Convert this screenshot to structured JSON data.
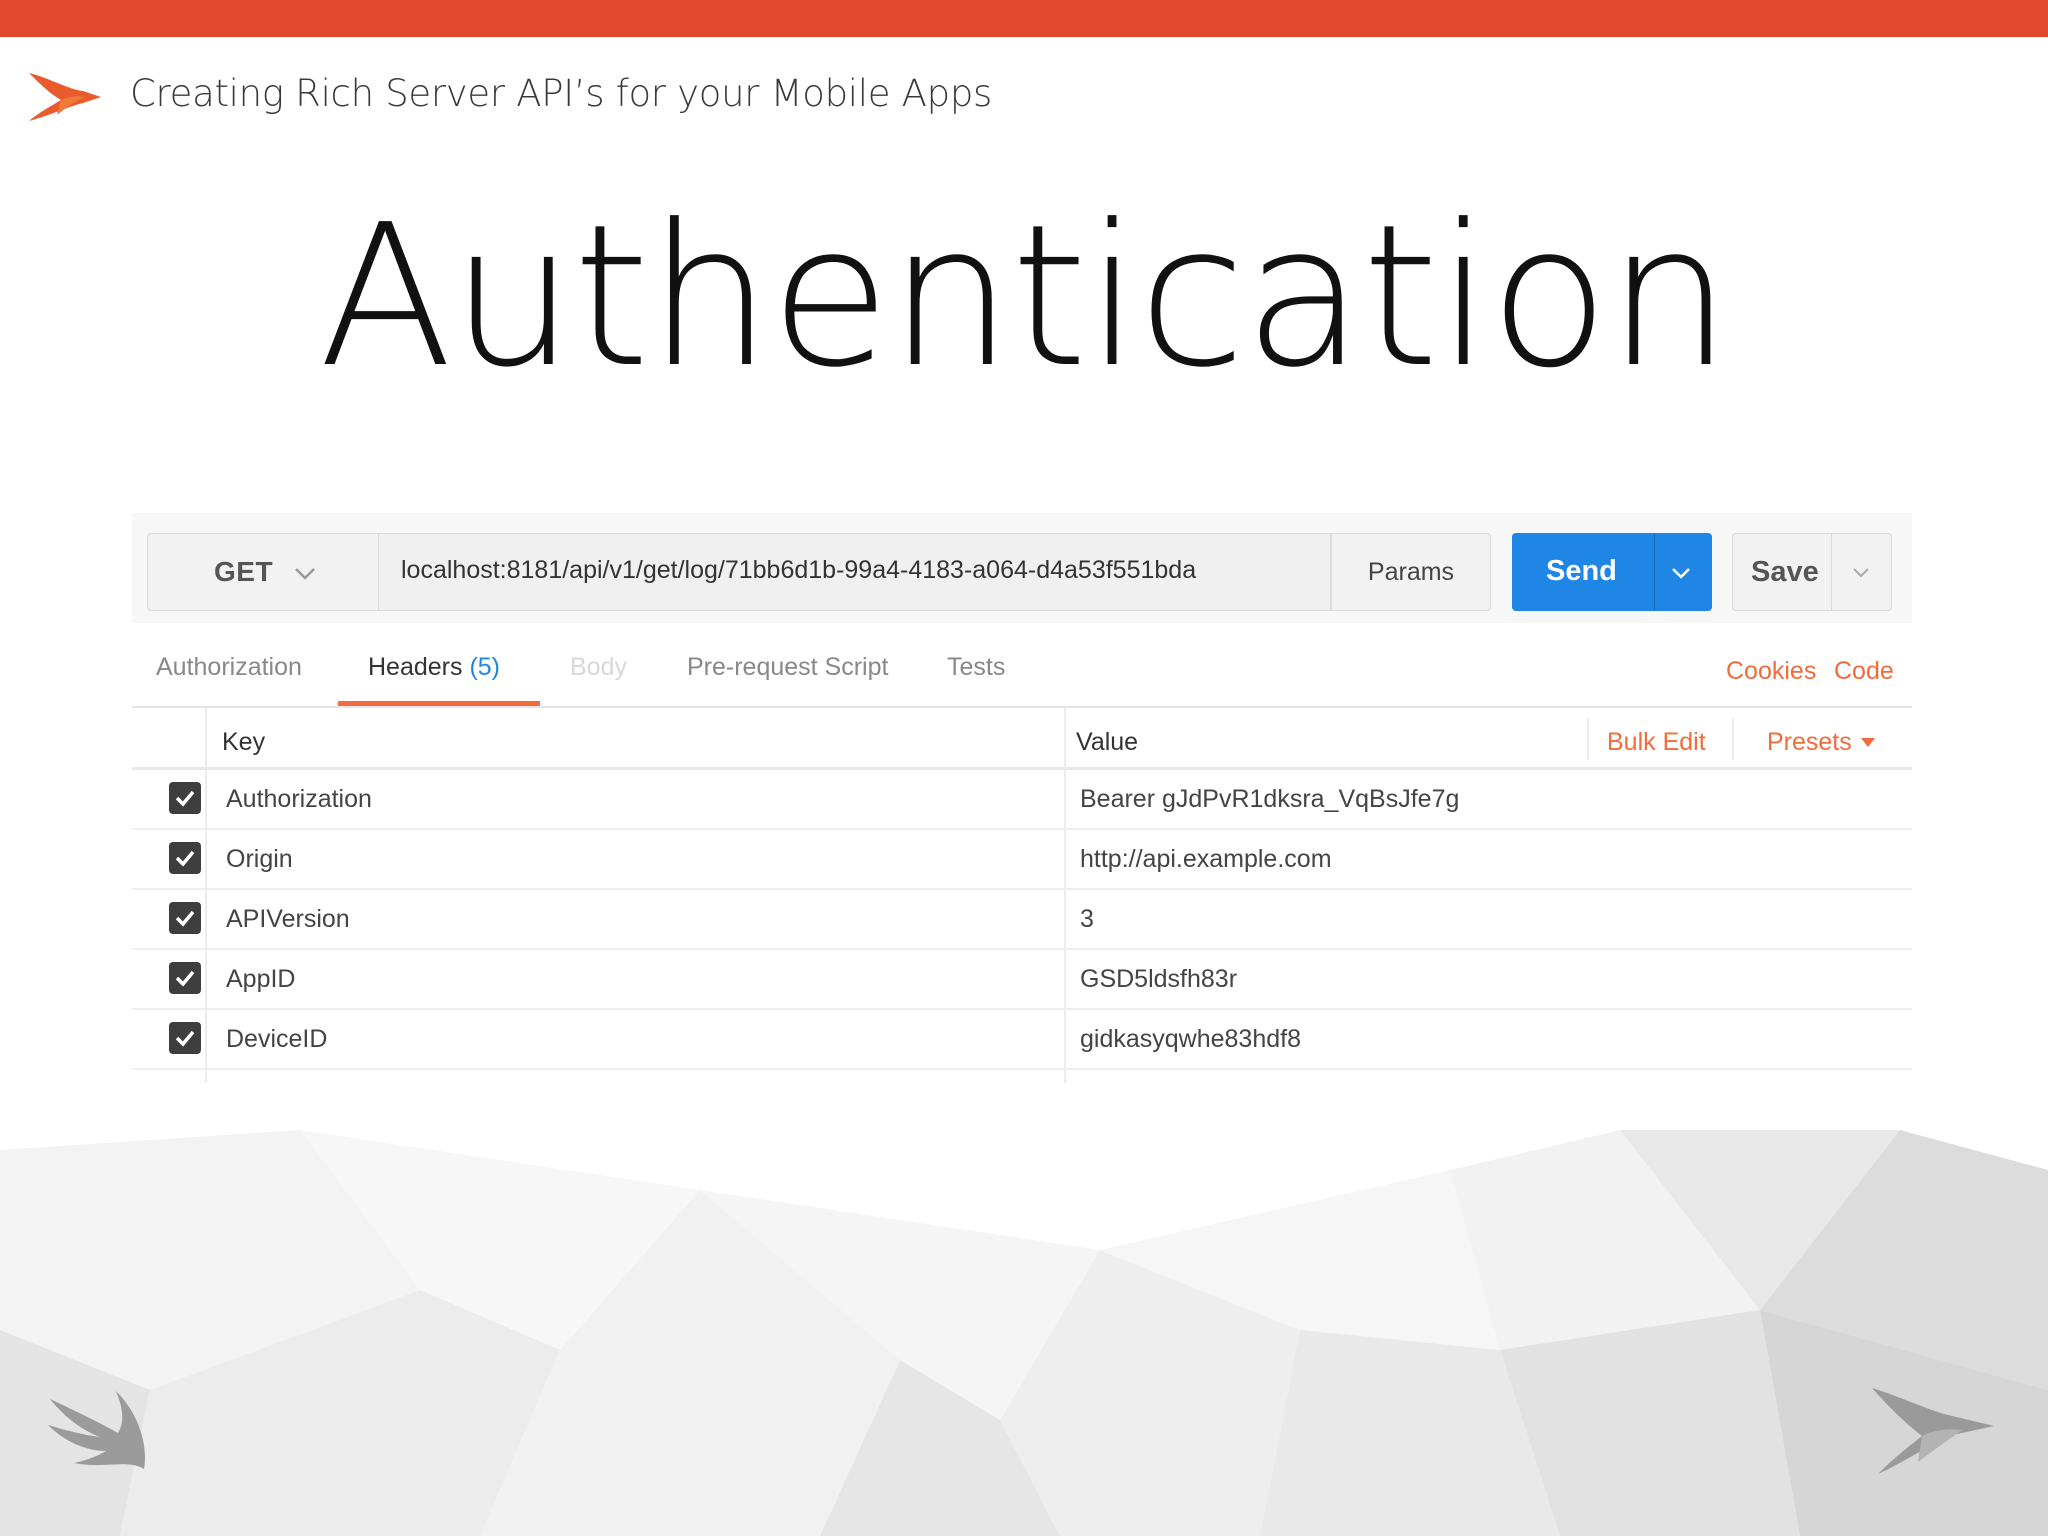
{
  "colors": {
    "brand": "#e2492c",
    "accent_orange": "#f26b3a",
    "send_blue": "#1f86e6"
  },
  "header": {
    "title": "Creating Rich Server API’s for your Mobile Apps",
    "logo_icon": "swift-bird-icon"
  },
  "slide": {
    "title": "Authentication"
  },
  "request": {
    "method": "GET",
    "url": "localhost:8181/api/v1/get/log/71bb6d1b-99a4-4183-a064-d4a53f551bda",
    "params_label": "Params",
    "send_label": "Send",
    "save_label": "Save"
  },
  "tabs": {
    "authorization": "Authorization",
    "headers": "Headers",
    "headers_count": "(5)",
    "body": "Body",
    "prerequest": "Pre-request Script",
    "tests": "Tests",
    "cookies": "Cookies",
    "code": "Code"
  },
  "table": {
    "key_header": "Key",
    "value_header": "Value",
    "bulk_edit": "Bulk Edit",
    "presets": "Presets",
    "rows": [
      {
        "checked": true,
        "key": "Authorization",
        "value": "Bearer gJdPvR1dksra_VqBsJfe7g"
      },
      {
        "checked": true,
        "key": "Origin",
        "value": "http://api.example.com"
      },
      {
        "checked": true,
        "key": "APIVersion",
        "value": "3"
      },
      {
        "checked": true,
        "key": "AppID",
        "value": "GSD5ldsfh83r"
      },
      {
        "checked": true,
        "key": "DeviceID",
        "value": "gidkasyqwhe83hdf8"
      }
    ]
  }
}
